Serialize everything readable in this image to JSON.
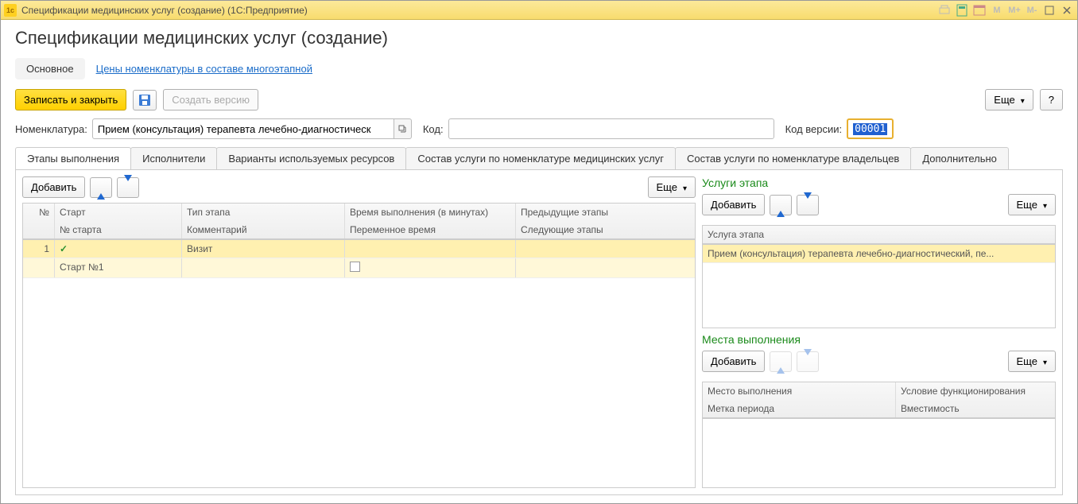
{
  "titlebar": {
    "text": "Спецификации медицинских услуг (создание)  (1С:Предприятие)",
    "icons": {
      "m": "M",
      "mplus": "M+",
      "mminus": "M-"
    }
  },
  "page": {
    "title": "Спецификации медицинских услуг (создание)"
  },
  "nav": {
    "main": "Основное",
    "prices": "Цены номенклатуры в составе многоэтапной"
  },
  "toolbar": {
    "write_close": "Записать и закрыть",
    "create_version": "Создать версию",
    "more": "Еще",
    "help": "?"
  },
  "form": {
    "nomen_label": "Номенклатура:",
    "nomen_value": "Прием (консультация) терапевта лечебно-диагностическ",
    "code_label": "Код:",
    "code_value": "",
    "version_label": "Код версии:",
    "version_value": "00001"
  },
  "tabs": {
    "t1": "Этапы выполнения",
    "t2": "Исполнители",
    "t3": "Варианты используемых ресурсов",
    "t4": "Состав услуги по номенклатуре медицинских услуг",
    "t5": "Состав услуги по номенклатуре владельцев",
    "t6": "Дополнительно"
  },
  "left": {
    "add": "Добавить",
    "more": "Еще",
    "head": {
      "n": "№",
      "start": "Старт",
      "type": "Тип этапа",
      "time": "Время выполнения (в минутах)",
      "prev": "Предыдущие этапы",
      "nstart": "№ старта",
      "comment": "Комментарий",
      "vartime": "Переменное время",
      "next": "Следующие этапы"
    },
    "row": {
      "n": "1",
      "type": "Визит",
      "start_n": "Старт №1"
    }
  },
  "right": {
    "services_title": "Услуги этапа",
    "add": "Добавить",
    "more": "Еще",
    "service_head": "Услуга этапа",
    "service_row": "Прием (консультация) терапевта лечебно-диагностический, пе...",
    "places_title": "Места выполнения",
    "places_head": {
      "place": "Место выполнения",
      "cond": "Условие функционирования",
      "period": "Метка периода",
      "capacity": "Вместимость"
    }
  }
}
